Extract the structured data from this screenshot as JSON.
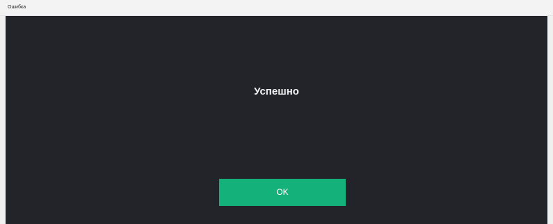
{
  "window": {
    "title": "Ошибка"
  },
  "dialog": {
    "message": "Успешно",
    "ok_label": "OK"
  },
  "colors": {
    "background": "#222429",
    "button": "#14b27a"
  }
}
